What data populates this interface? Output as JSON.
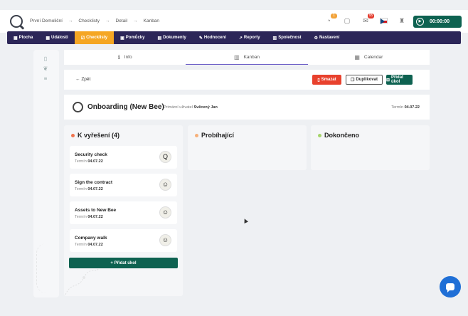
{
  "breadcrumbs": [
    "První Demoliční",
    "Checklisty",
    "Detail",
    "Kanban"
  ],
  "top_icons": {
    "notifications_badge": "1",
    "messages_badge": "",
    "mail_badge": "95"
  },
  "timer": "00:00:00",
  "nav": [
    {
      "label": "Plocha",
      "icon": "dashboard-icon"
    },
    {
      "label": "Události",
      "icon": "calendar-icon"
    },
    {
      "label": "Checklisty",
      "icon": "checklist-icon",
      "active": true
    },
    {
      "label": "Pomůcky",
      "icon": "tools-icon"
    },
    {
      "label": "Dokumenty",
      "icon": "document-icon"
    },
    {
      "label": "Hodnocení",
      "icon": "rating-icon"
    },
    {
      "label": "Reporty",
      "icon": "chart-icon"
    },
    {
      "label": "Společnost",
      "icon": "company-icon"
    },
    {
      "label": "Nastavení",
      "icon": "gear-icon"
    }
  ],
  "tabs": [
    {
      "label": "Info",
      "icon": "info-icon"
    },
    {
      "label": "Kanban",
      "icon": "kanban-icon",
      "active": true
    },
    {
      "label": "Calendar",
      "icon": "calendar-icon"
    }
  ],
  "actions": {
    "back": "Zpět",
    "delete": "Smazat",
    "duplicate": "Duplikovat",
    "add_task": "Přidat úkol"
  },
  "checklist": {
    "title": "Onboarding (New Bee)",
    "user_label": "Primární uživatel",
    "user_name": "Svěcený Jan",
    "term_label": "Termín",
    "term_date": "04.07.22"
  },
  "columns": [
    {
      "title": "K vyřešení (4)",
      "color": "#f0744e"
    },
    {
      "title": "Probíhající",
      "color": "#f7b07a"
    },
    {
      "title": "Dokončeno",
      "color": "#a5d46a"
    }
  ],
  "tasks": [
    {
      "name": "Security check",
      "term_label": "Termín",
      "date": "04.07.22",
      "avatar": "Q"
    },
    {
      "name": "Sign the contract",
      "term_label": "Termín",
      "date": "04.07.22",
      "avatar": "☺"
    },
    {
      "name": "Assets to New Bee",
      "term_label": "Termín",
      "date": "04.07.22",
      "avatar": "☺"
    },
    {
      "name": "Company walk",
      "term_label": "Termín",
      "date": "04.07.22",
      "avatar": "☺"
    }
  ],
  "add_task_column": "+ Přidat úkol",
  "colors": {
    "nav_bg": "#2c2658",
    "nav_active": "#f5a623",
    "primary": "#0e6251",
    "danger": "#e8412d",
    "chat": "#1f6fd6"
  }
}
